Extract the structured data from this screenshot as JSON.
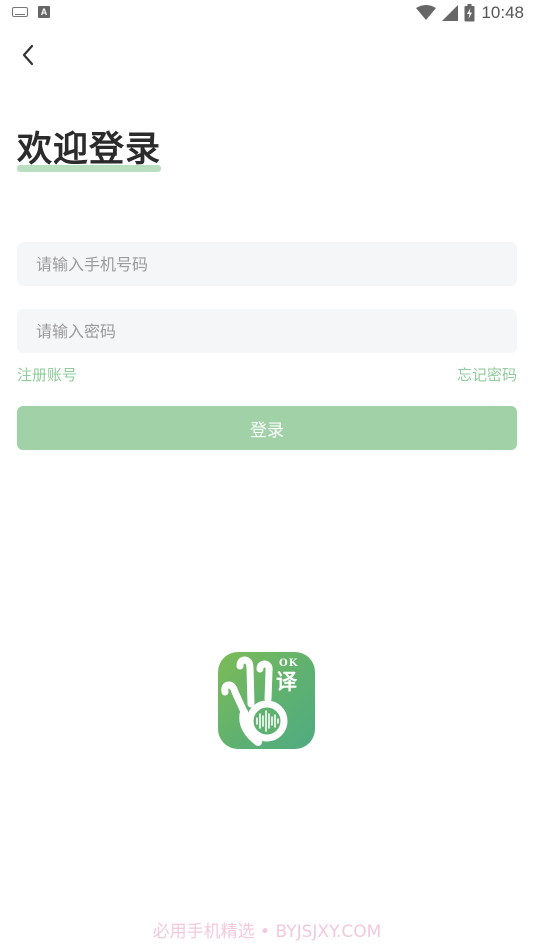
{
  "status_bar": {
    "time": "10:48",
    "left_icons": [
      "keyboard-icon",
      "a-notification-icon"
    ],
    "right_icons": [
      "wifi-icon",
      "signal-icon",
      "battery-charging-icon"
    ]
  },
  "header": {
    "back_icon": "chevron-left-icon"
  },
  "main": {
    "title": "欢迎登录",
    "phone_placeholder": "请输入手机号码",
    "phone_value": "",
    "password_placeholder": "请输入密码",
    "password_value": "",
    "register_label": "注册账号",
    "forgot_label": "忘记密码",
    "login_label": "登录"
  },
  "logo": {
    "text_ok": "OK",
    "text_char": "译"
  },
  "watermark": {
    "text": "必用手机精选 • BYJSJXY.COM"
  },
  "colors": {
    "accent": "#a0d1a7",
    "link": "#90cb9b",
    "title_highlight": "#b9dec0",
    "input_bg": "#f5f6f8",
    "logo_gradient_start": "#7dbb57",
    "logo_gradient_end": "#4eab82",
    "watermark": "#f2c9dc"
  }
}
